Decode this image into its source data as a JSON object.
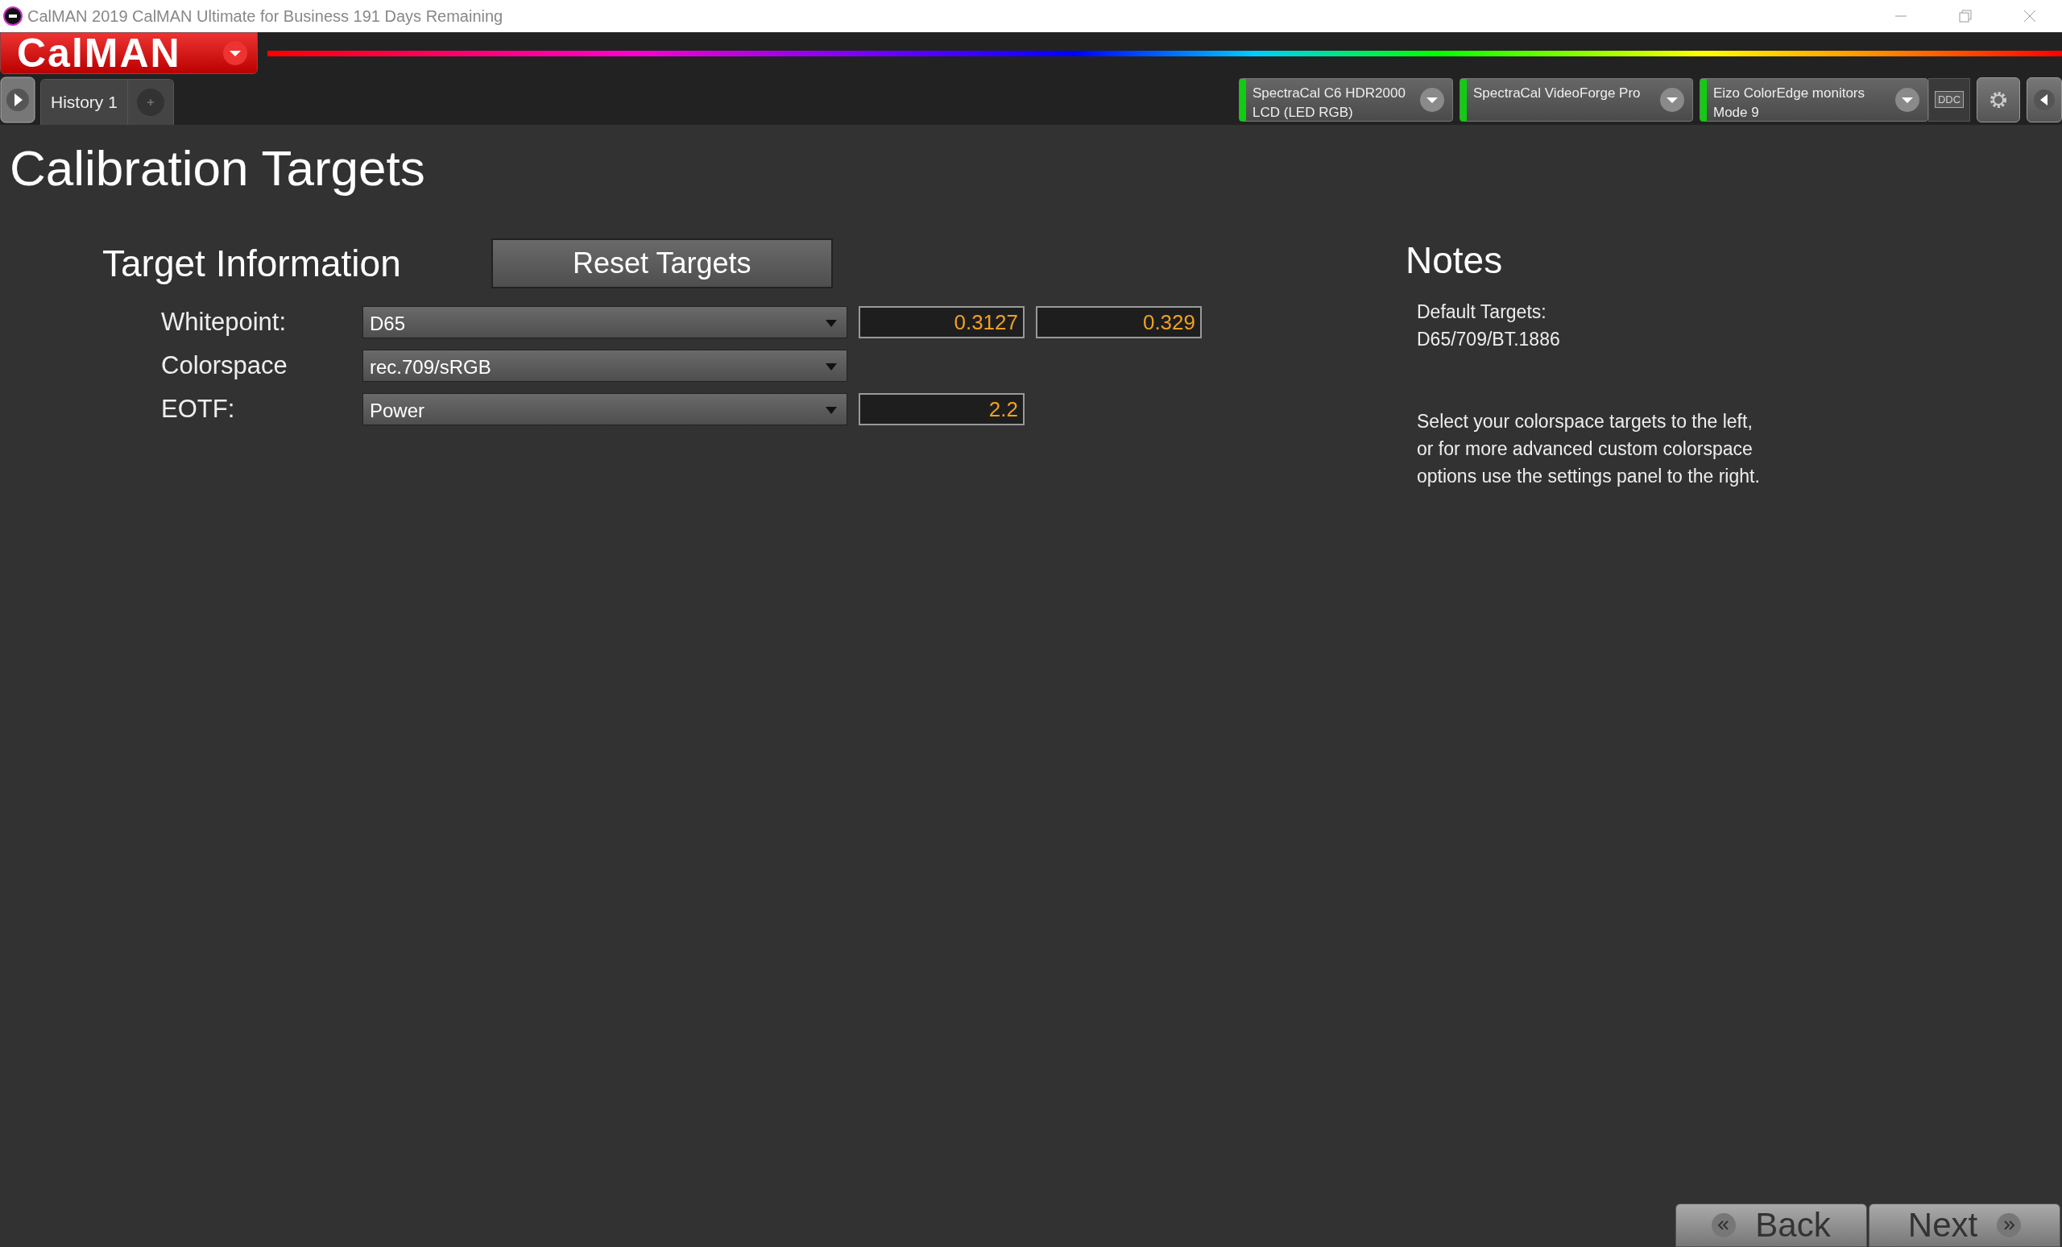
{
  "window": {
    "title": "CalMAN 2019 CalMAN Ultimate for Business 191 Days Remaining"
  },
  "app_menu": {
    "label": "CalMAN"
  },
  "history_tabs": [
    {
      "label": "History 1",
      "selected": true
    }
  ],
  "devices": [
    {
      "line1": "SpectraCal C6 HDR2000",
      "line2": "LCD (LED RGB)",
      "connected": true
    },
    {
      "line1": "SpectraCal VideoForge Pro",
      "connected": true
    },
    {
      "line1": "Eizo ColorEdge monitors",
      "line2": "Mode 9",
      "connected": true
    }
  ],
  "ddc_label": "DDC",
  "page": {
    "title": "Calibration Targets"
  },
  "target_information": {
    "heading": "Target Information",
    "reset_button": "Reset Targets",
    "rows": [
      {
        "label": "Whitepoint:",
        "selection": "D65",
        "values": [
          "0.3127",
          "0.329"
        ]
      },
      {
        "label": "Colorspace",
        "selection": "rec.709/sRGB"
      },
      {
        "label": "EOTF:",
        "selection": "Power",
        "values": [
          "2.2"
        ]
      }
    ]
  },
  "notes": {
    "heading": "Notes",
    "default_label": "Default Targets:",
    "default_value": "D65/709/BT.1886",
    "description": "Select your colorspace targets to the left,\nor for more advanced custom colorspace\noptions use the settings panel to the right."
  },
  "navigation": {
    "back": "Back",
    "next": "Next"
  }
}
